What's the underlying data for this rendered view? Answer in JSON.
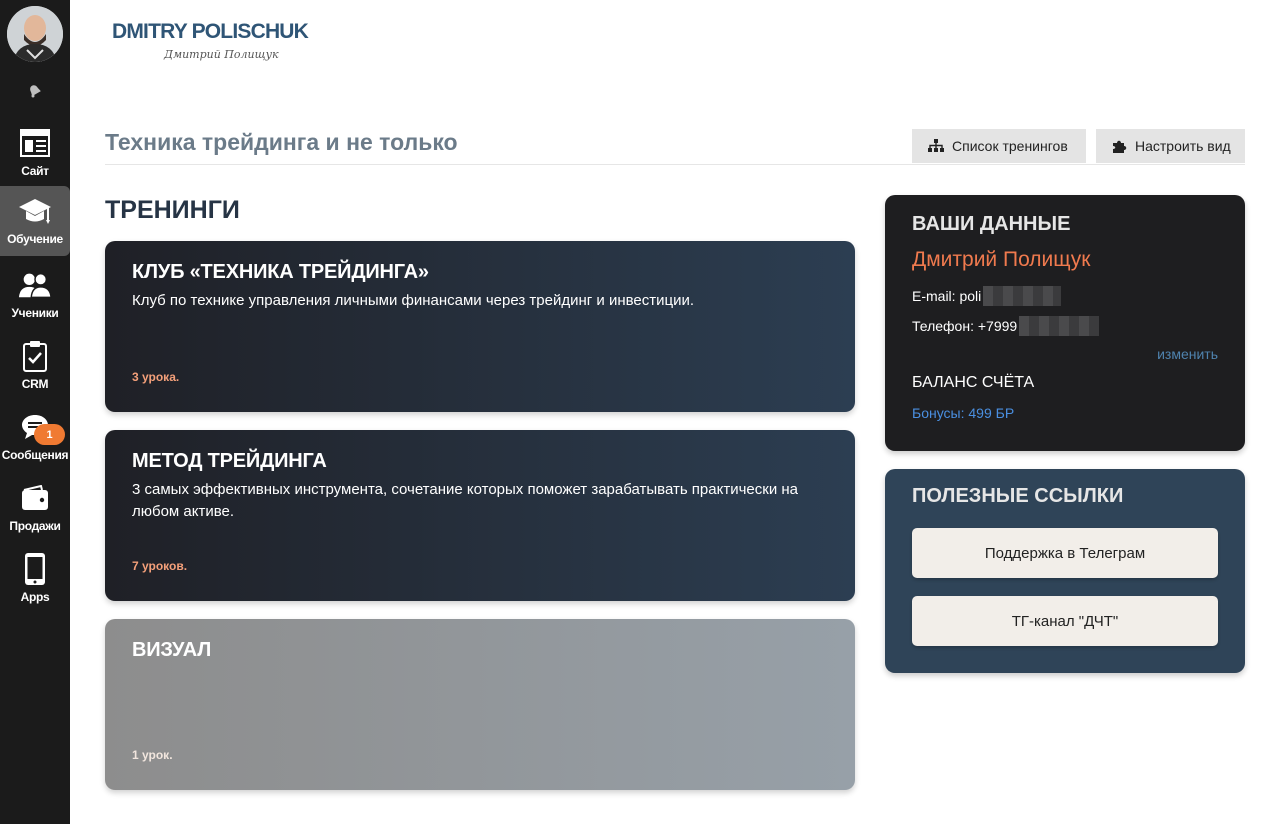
{
  "sidebar": {
    "badge_count": "1",
    "items": [
      {
        "label": "Сайт",
        "icon": "website-icon"
      },
      {
        "label": "Обучение",
        "icon": "graduation-cap-icon"
      },
      {
        "label": "Ученики",
        "icon": "users-icon"
      },
      {
        "label": "CRM",
        "icon": "clipboard-check-icon"
      },
      {
        "label": "Сообщения",
        "icon": "chat-icon"
      },
      {
        "label": "Продажи",
        "icon": "wallet-icon"
      },
      {
        "label": "Apps",
        "icon": "phone-icon"
      }
    ]
  },
  "logo": {
    "brand": "DMITRY POLISCHUK",
    "signature": "Дмитрий Полищук"
  },
  "header": {
    "title": "Техника трейдинга и не только",
    "btn_trainings": "Список тренингов",
    "btn_customize": "Настроить вид"
  },
  "main": {
    "section_title": "ТРЕНИНГИ",
    "courses": [
      {
        "title": "КЛУБ «ТЕХНИКА ТРЕЙДИНГА»",
        "desc": "Клуб по технике управления личными финансами через трейдинг и инвестиции.",
        "lessons": "3 урока."
      },
      {
        "title": "МЕТОД ТРЕЙДИНГА",
        "desc": "3 самых эффективных инструмента, сочетание которых поможет зарабатывать практически на любом активе.",
        "lessons": "7 уроков."
      },
      {
        "title": "ВИЗУАЛ",
        "desc": "",
        "lessons": "1 урок."
      }
    ]
  },
  "user": {
    "title": "ВАШИ ДАННЫЕ",
    "name": "Дмитрий Полищук",
    "email_label": "E-mail: poli",
    "phone_label": "Телефон: +7999",
    "change": "изменить",
    "balance_title": "БАЛАНС СЧЁТА",
    "bonus": "Бонусы: 499 БР"
  },
  "links": {
    "title": "ПОЛЕЗНЫЕ ССЫЛКИ",
    "items": [
      "Поддержка в Телеграм",
      "ТГ-канал \"ДЧТ\""
    ]
  },
  "colors": {
    "sidebar_bg": "#1b1b1b",
    "accent_orange": "#f07a4e",
    "brand_blue": "#2f5576",
    "links_panel": "#2f4458"
  }
}
